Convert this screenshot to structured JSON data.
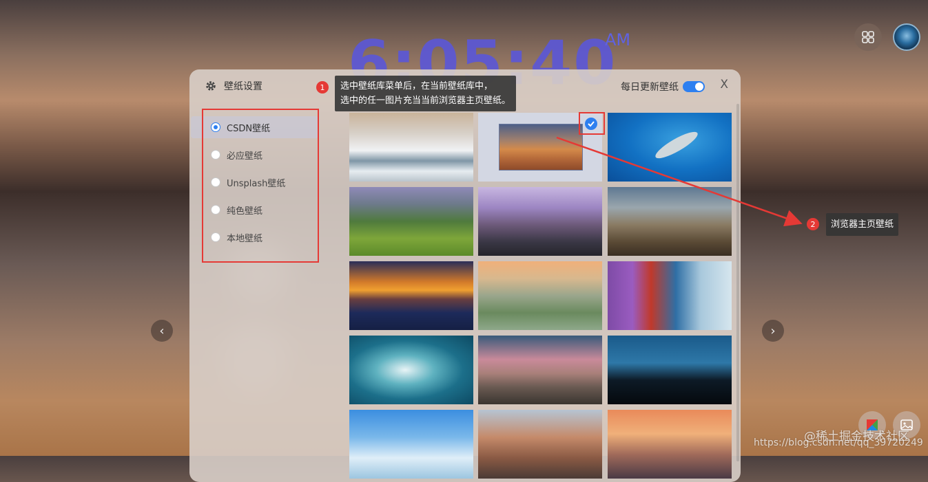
{
  "clock": {
    "time": "6:05:40",
    "ampm": "AM"
  },
  "dialog": {
    "title": "壁纸设置",
    "daily_update_label": "每日更新壁纸",
    "daily_update_on": true,
    "close_label": "X"
  },
  "sidebar": {
    "items": [
      {
        "label": "CSDN壁纸",
        "selected": true
      },
      {
        "label": "必应壁纸",
        "selected": false
      },
      {
        "label": "Unsplash壁纸",
        "selected": false
      },
      {
        "label": "纯色壁纸",
        "selected": false
      },
      {
        "label": "本地壁纸",
        "selected": false
      }
    ]
  },
  "annotations": {
    "one": {
      "number": "1",
      "line1": "选中壁纸库菜单后，在当前壁纸库中，",
      "line2": "选中的任一图片充当当前浏览器主页壁纸。"
    },
    "two": {
      "number": "2",
      "text": "浏览器主页壁纸"
    }
  },
  "watermark": {
    "line1": "@稀土掘金技术社区",
    "line2": "https://blog.csdn.net/qq_39720249"
  },
  "thumbnails": [
    "snowy-mountains",
    "selected-beach-sunset",
    "whale-underwater",
    "green-valley",
    "purple-mountains",
    "canyon-cliffs",
    "sunset-pier",
    "misty-hills",
    "colorful-houses",
    "ocean-wave",
    "pink-sky-hill",
    "dark-silhouette-hill",
    "blue-sky-clouds",
    "rocky-peaks",
    "sunset-lake"
  ],
  "colors": {
    "accent": "#2d7ff0",
    "annotation_red": "#e53935",
    "clock": "#5b57d8"
  }
}
